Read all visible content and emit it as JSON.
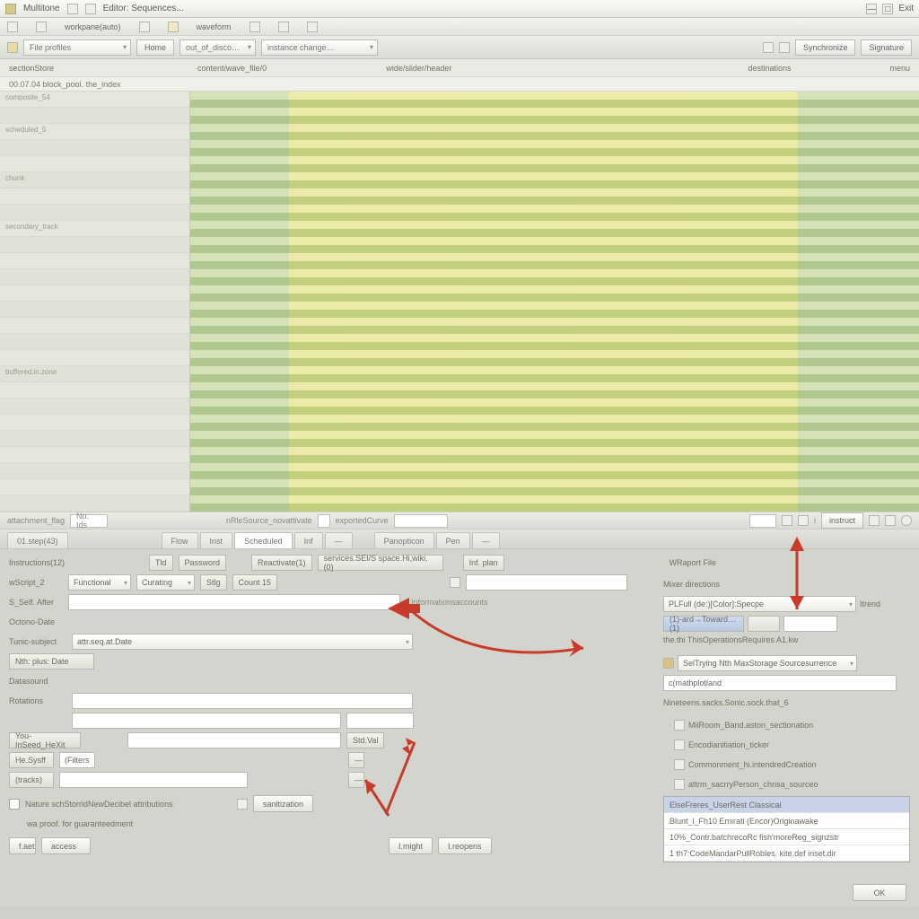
{
  "title": {
    "app": "Multitone",
    "doc": "Editor: Sequences..."
  },
  "title_right": {
    "a": "—",
    "b": "□",
    "c": "Exit"
  },
  "menu": {
    "m1": "workpane(auto)",
    "m2": "",
    "m3": "waveform",
    "m4": "",
    "m5": ""
  },
  "toolbar": {
    "dd1": "File   profiles",
    "dd2": "out_of_disco…",
    "dd3": "instance change…",
    "btn_home": "Home",
    "btn_sync": "Synchronize",
    "btn_set": "Signature"
  },
  "labels": {
    "l1": "sectionStore",
    "l2": "content/wave_file/0",
    "l3": "wide/slider/header",
    "l4": "destinations",
    "l5": "menu"
  },
  "timeline": {
    "left": "00.07.04  block_pool. the_index",
    "right": ""
  },
  "tracks": [
    "composite_54",
    "",
    "scheduled_5",
    "",
    "",
    "chunk",
    "",
    "",
    "secondary_track",
    "",
    "",
    "",
    "",
    "",
    "",
    "",
    "",
    "buffered.in.zone",
    "",
    "",
    "",
    "",
    "",
    "",
    "",
    ""
  ],
  "status": {
    "s1": "attachment_flag",
    "s2": "No. Ids",
    "s3": "nRleSource_novattivate",
    "s4": "exportedCurve",
    "s5": "",
    "btn_l": "instruct",
    "btn_i": "i"
  },
  "tabs": {
    "t1": "01.step(43)",
    "t2": "Flow",
    "t3": "Inst",
    "t4": "Scheduled",
    "t5": "Inf",
    "t6": "—",
    "t7": "Panopticon",
    "t8": "Pen",
    "t9": "—"
  },
  "form": {
    "r1_lbl": "Instructions(12)",
    "r1_b1": "Tld",
    "r1_b2": "Password",
    "r1_b3": "Reactivate(1)",
    "r1_b4": "services.SEI/S space.Hi,wiki.(0)",
    "r1_b5": "Inf. plan",
    "r1_r": "WRaport File",
    "r2_lbl": "wScript_2",
    "r2_dd1": "Functional",
    "r2_dd2": "Curating",
    "r2_b1": "Stlg",
    "r2_b2": "Count 15",
    "r3_lbl": "S_Self. After",
    "r3_hint": "Informationsaccounts",
    "r4_lbl": "Octono-Date",
    "r5_lbl": "Tunic-subject",
    "r5_val": "attr.seq.at.Date",
    "r6_lbl": "Nth: plus: Date",
    "r7_lbl": "Datasound",
    "r8_lbl": "Rotations",
    "r8_empty1": "",
    "r8_empty2": "",
    "r9_lbl": "You-InSeed_HeXit",
    "r9_val": "",
    "r9_btn": "Std.Val",
    "r10_lbl": "He.Sysff",
    "r10_val": "(Filters",
    "r10_btn": "—",
    "r11_lbl": "(tracks)",
    "r11_btn": "—",
    "r12_chk": "Nature schStorridNewDecibel attributions",
    "r12_btn": "sanitization",
    "r12_lbl2": "wa proof. for guaranteedment",
    "b_f1": "f.aet",
    "b_f2": "access",
    "b_b1": "I.might",
    "b_b2": "I.reopens"
  },
  "rpanel": {
    "head": "Mixer directions",
    "search_val": "PLFull (de:)[Color]:Specpe",
    "search_btn": "Itrend",
    "b1": "(1)-ard→Toward…(1)",
    "b2": "",
    "lbl1": "the.thi ThisOperationsRequires A1.kw",
    "row1": "SelTrying  Nth   MaxStorage  Sourcesurrence",
    "row2": "c(mathplotland",
    "tree_head": "Nineteens.sacks.Sonic.sock.that_6",
    "tree_i1": "MilRoom_Band.aston_sectionation",
    "tree_i2": "Encodianitiation_ticker",
    "tree_i3": "Commonment_hi.intendredCreation",
    "tree_i4": "attrm_sacrryPerson_chrisa_sourceo",
    "list_i1": "ElseFreres_UserRest Classical",
    "list_i2": "Blunt_l_Fh10 Emirati (Encor)Originawake",
    "list_i3": "10%_Contr.batchrecoRc fish'moreReg_signzstr",
    "list_i4": "1 th7:CodeMandarPullRobles. kite.def inset.dir",
    "ok": "OK"
  }
}
